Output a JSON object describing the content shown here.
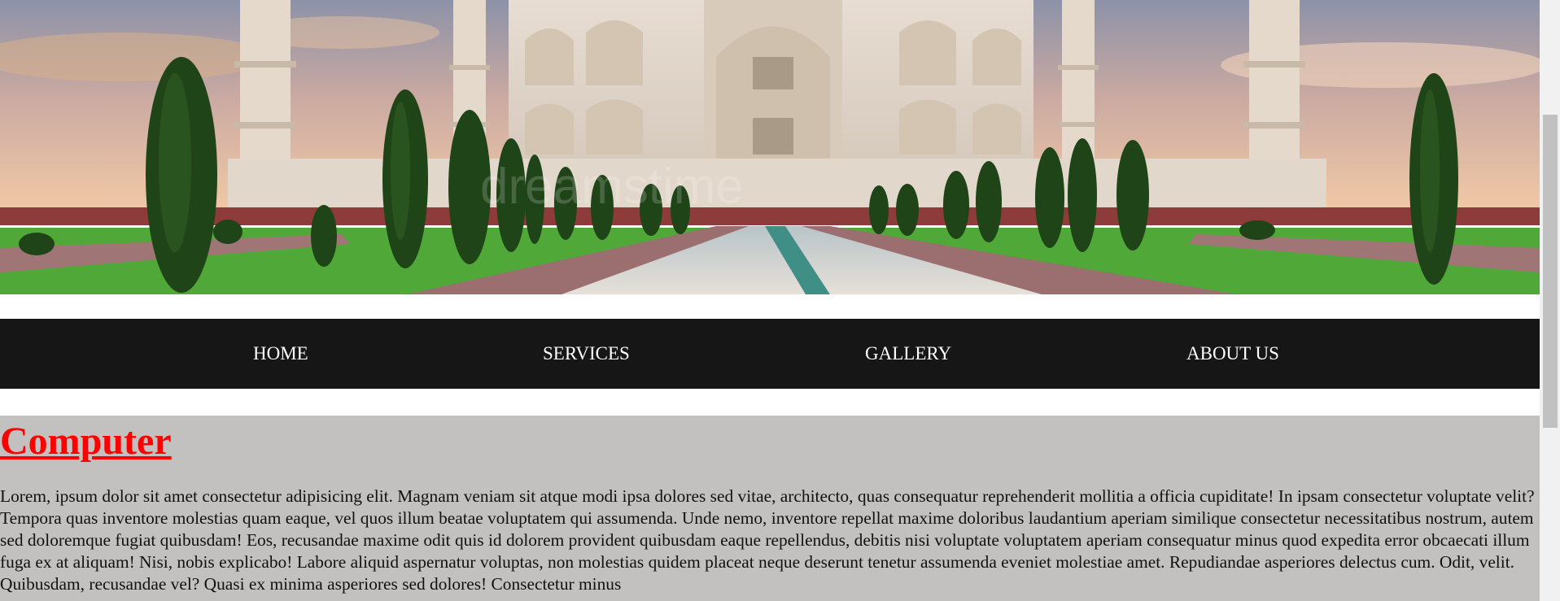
{
  "hero": {
    "image": "taj-mahal-banner",
    "watermark": "dreamstime"
  },
  "nav": {
    "items": [
      {
        "label": "HOME"
      },
      {
        "label": "SERVICES"
      },
      {
        "label": "GALLERY"
      },
      {
        "label": "ABOUT US"
      }
    ]
  },
  "content": {
    "heading": "Computer",
    "body": "Lorem, ipsum dolor sit amet consectetur adipisicing elit. Magnam veniam sit atque modi ipsa dolores sed vitae, architecto, quas consequatur reprehenderit mollitia a officia cupiditate! In ipsam consectetur voluptate velit? Tempora quas inventore molestias quam eaque, vel quos illum beatae voluptatem qui assumenda. Unde nemo, inventore repellat maxime doloribus laudantium aperiam similique consectetur necessitatibus nostrum, autem sed doloremque fugiat quibusdam! Eos, recusandae maxime odit quis id dolorem provident quibusdam eaque repellendus, debitis nisi voluptate voluptatem aperiam consequatur minus quod expedita error obcaecati illum fuga ex at aliquam! Nisi, nobis explicabo! Labore aliquid aspernatur voluptas, non molestias quidem placeat neque deserunt tenetur assumenda eveniet molestiae amet. Repudiandae asperiores delectus cum. Odit, velit. Quibusdam, recusandae vel? Quasi ex minima asperiores sed dolores! Consectetur minus"
  },
  "colors": {
    "nav_background": "#161616",
    "heading": "#ff0000",
    "content_background": "#c3c0c0"
  }
}
